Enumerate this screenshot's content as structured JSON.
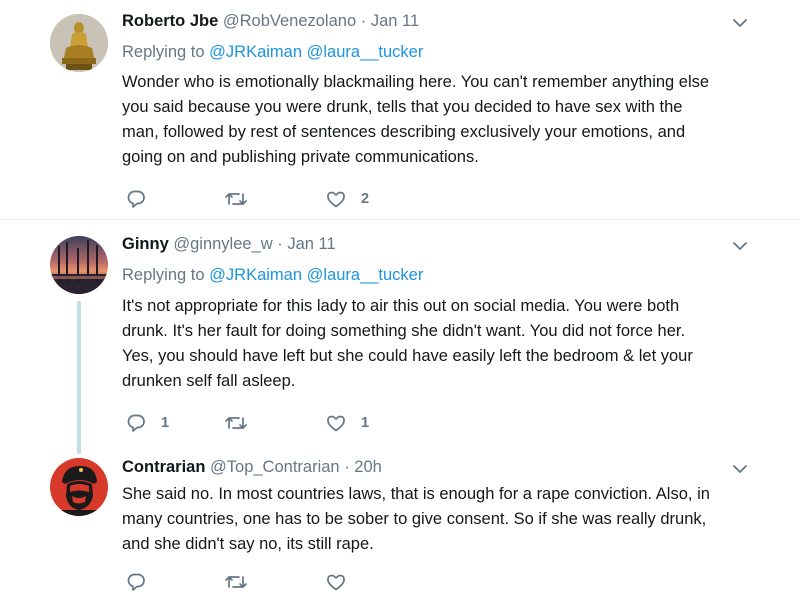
{
  "tweets": [
    {
      "name": "Roberto Jbe",
      "handle": "@RobVenezolano",
      "sep": "·",
      "time": "Jan 11",
      "replying_prefix": "Replying to",
      "mentions": [
        "@JRKaiman",
        "@laura__tucker"
      ],
      "lines": [
        "Wonder who is emotionally blackmailing here. You can't remember anything else",
        "you said because you were drunk,  tells that you decided to have sex with the",
        "man, followed by rest of sentences describing exclusively your emotions, and",
        "going on and publishing private communications."
      ],
      "reply_count": "",
      "retweet_count": "",
      "like_count": "2",
      "avatar": "golden-statue"
    },
    {
      "name": "Ginny",
      "handle": "@ginnylee_w",
      "sep": "·",
      "time": "Jan 11",
      "replying_prefix": "Replying to",
      "mentions": [
        "@JRKaiman",
        "@laura__tucker"
      ],
      "lines": [
        "It's not appropriate for this lady to air this out on social media. You were both",
        "drunk. It's her fault for doing something she didn't want. You did not force her.",
        "Yes, you should have left but she could have easily left the bedroom & let your",
        "drunken self fall asleep."
      ],
      "reply_count": "1",
      "retweet_count": "",
      "like_count": "1",
      "avatar": "sunset-trees"
    },
    {
      "name": "Contrarian",
      "handle": "@Top_Contrarian",
      "sep": "·",
      "time": "20h",
      "lines": [
        "She said no. In most countries laws, that is enough for a rape conviction. Also, in",
        "many countries, one has to be sober to give consent. So if she was really drunk,",
        "and she didn't say no, its still rape."
      ],
      "reply_count": "",
      "retweet_count": "",
      "like_count": "",
      "avatar": "che-portrait"
    }
  ],
  "colors": {
    "link": "#1b95e0",
    "muted": "#657786",
    "text": "#14171a",
    "divider": "#e6ecf0",
    "thread": "#c4dbec"
  },
  "icons": [
    "reply-icon",
    "retweet-icon",
    "like-icon",
    "caret-down-icon"
  ]
}
